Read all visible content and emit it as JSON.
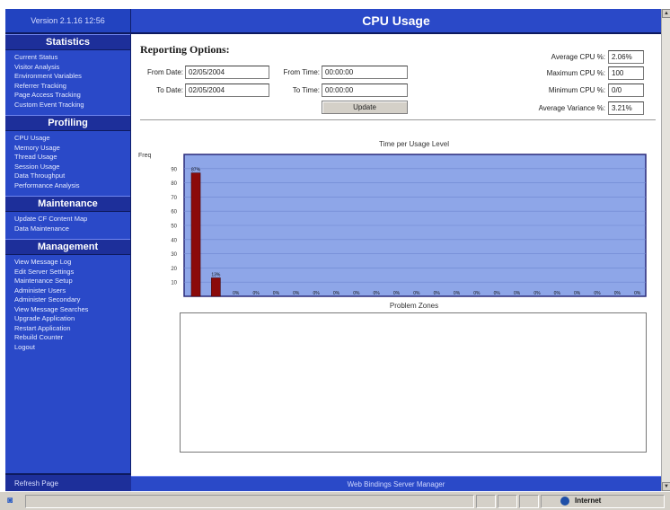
{
  "sidebar": {
    "version": "Version 2.1.16 12:56",
    "sections": [
      {
        "title": "Statistics",
        "items": [
          "Current Status",
          "Visitor Analysis",
          "Environment Variables",
          "Referrer Tracking",
          "Page Access Tracking",
          "Custom Event Tracking"
        ]
      },
      {
        "title": "Profiling",
        "items": [
          "CPU Usage",
          "Memory Usage",
          "Thread Usage",
          "Session Usage",
          "Data Throughput",
          "Performance Analysis"
        ]
      },
      {
        "title": "Maintenance",
        "items": [
          "Update CF Content Map",
          "Data Maintenance"
        ]
      },
      {
        "title": "Management",
        "items": [
          "View Message Log",
          "Edit Server Settings",
          "Maintenance Setup",
          "Administer Users",
          "Administer Secondary",
          "View Message Searches",
          "Upgrade Application",
          "Restart Application",
          "Rebuild Counter",
          "Logout"
        ]
      }
    ],
    "bottom_label": "Refresh Page"
  },
  "header": {
    "title": "CPU Usage"
  },
  "options": {
    "title": "Reporting Options:",
    "from_date_label": "From Date:",
    "from_date_value": "02/05/2004",
    "to_date_label": "To Date:",
    "to_date_value": "02/05/2004",
    "from_time_label": "From Time:",
    "from_time_value": "00:00:00",
    "to_time_label": "To Time:",
    "to_time_value": "00:00:00",
    "update_label": "Update"
  },
  "stats": {
    "avg_cpu_label": "Average CPU %:",
    "avg_cpu_value": "2.06%",
    "max_cpu_label": "Maximum CPU %:",
    "max_cpu_value": "100",
    "min_cpu_label": "Minimum CPU %:",
    "min_cpu_value": "0/0",
    "avg_var_label": "Average Variance %:",
    "avg_var_value": "3.21%"
  },
  "chart_data": {
    "type": "bar",
    "title": "Time per Usage Level",
    "ylabel": "Freq",
    "yticks": [
      "90",
      "80",
      "70",
      "60",
      "50",
      "40",
      "30",
      "20",
      "10"
    ],
    "ylim": [
      0,
      100
    ],
    "grid": true,
    "bar_color": "#8b0a0a",
    "plot_color": "#8ea6e8",
    "categories": [
      "",
      "",
      "",
      "",
      "",
      "",
      "",
      "",
      "",
      "",
      "",
      "",
      "",
      "",
      "",
      "",
      "",
      "",
      "",
      "",
      "",
      "",
      ""
    ],
    "values": [
      87,
      13,
      0,
      0,
      0,
      0,
      0,
      0,
      0,
      0,
      0,
      0,
      0,
      0,
      0,
      0,
      0,
      0,
      0,
      0,
      0,
      0,
      0
    ],
    "value_labels": [
      "87%",
      "13%",
      "0%",
      "0%",
      "0%",
      "0%",
      "0%",
      "0%",
      "0%",
      "0%",
      "0%",
      "0%",
      "0%",
      "0%",
      "0%",
      "0%",
      "0%",
      "0%",
      "0%",
      "0%",
      "0%",
      "0%",
      "0%"
    ]
  },
  "problem_zones": {
    "title": "Problem Zones"
  },
  "footer": {
    "text": "Web Bindings Server Manager"
  },
  "statusbar": {
    "zone": "Internet"
  },
  "colors": {
    "accent": "#2a49c8",
    "dark_accent": "#1d2f9a"
  }
}
